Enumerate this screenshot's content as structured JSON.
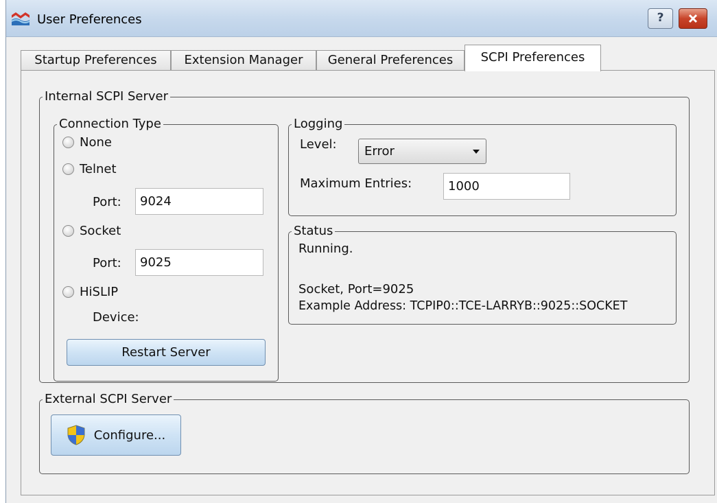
{
  "window": {
    "title": "User Preferences",
    "help_label": "?",
    "close_label": "x"
  },
  "tabs": [
    {
      "label": "Startup Preferences"
    },
    {
      "label": "Extension Manager"
    },
    {
      "label": "General Preferences"
    },
    {
      "label": "SCPI Preferences"
    }
  ],
  "internal": {
    "legend": "Internal SCPI Server",
    "connection": {
      "legend": "Connection Type",
      "none_label": "None",
      "telnet_label": "Telnet",
      "telnet_port_label": "Port:",
      "telnet_port_value": "9024",
      "socket_label": "Socket",
      "socket_port_label": "Port:",
      "socket_port_value": "9025",
      "hislip_label": "HiSLIP",
      "device_label": "Device:",
      "restart_label": "Restart Server"
    },
    "logging": {
      "legend": "Logging",
      "level_label": "Level:",
      "level_value": "Error",
      "max_entries_label": "Maximum Entries:",
      "max_entries_value": "1000"
    },
    "status": {
      "legend": "Status",
      "line1": "Running.",
      "line2": "Socket, Port=9025",
      "line3": "Example Address: TCPIP0::TCE-LARRYB::9025::SOCKET"
    }
  },
  "external": {
    "legend": "External SCPI Server",
    "configure_label": "Configure..."
  }
}
